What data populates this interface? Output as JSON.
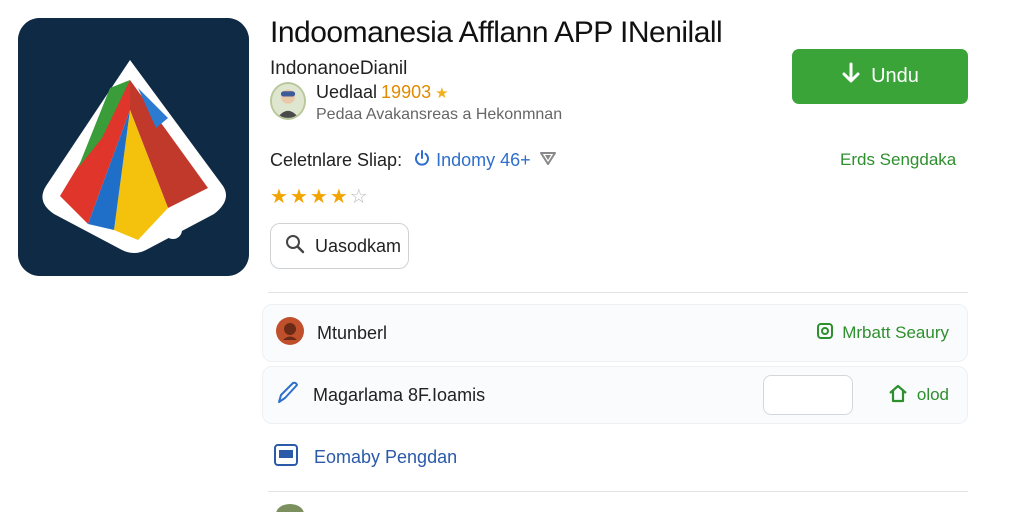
{
  "app": {
    "title": "Indoomanesia Afflann APP INenilall",
    "developer": "IndonanoeDianil",
    "icon_name": "app-logo-icon"
  },
  "author": {
    "name": "Uedlaal",
    "rating": "19903",
    "subtitle": "Pedaa Avakansreas a Hekonmnan"
  },
  "download": {
    "label": "Undu",
    "color": "#3aa438"
  },
  "category": {
    "label": "Celetnlare Sliap:",
    "value": "Indomy 46+",
    "side_link": "Erds Sengdaka"
  },
  "rating_stars": {
    "filled": 4.5,
    "max": 5
  },
  "search": {
    "label": "Uasodkam"
  },
  "rows": [
    {
      "label": "Mtunberl",
      "action": "Mrbatt Seaury"
    },
    {
      "label": "Magarlama 8F.Ioamis",
      "action": "olod"
    },
    {
      "label": "Eomaby Pengdan"
    }
  ],
  "colors": {
    "accent_green": "#3aa438",
    "link_blue": "#2e6fcb",
    "star": "#f2a400"
  }
}
